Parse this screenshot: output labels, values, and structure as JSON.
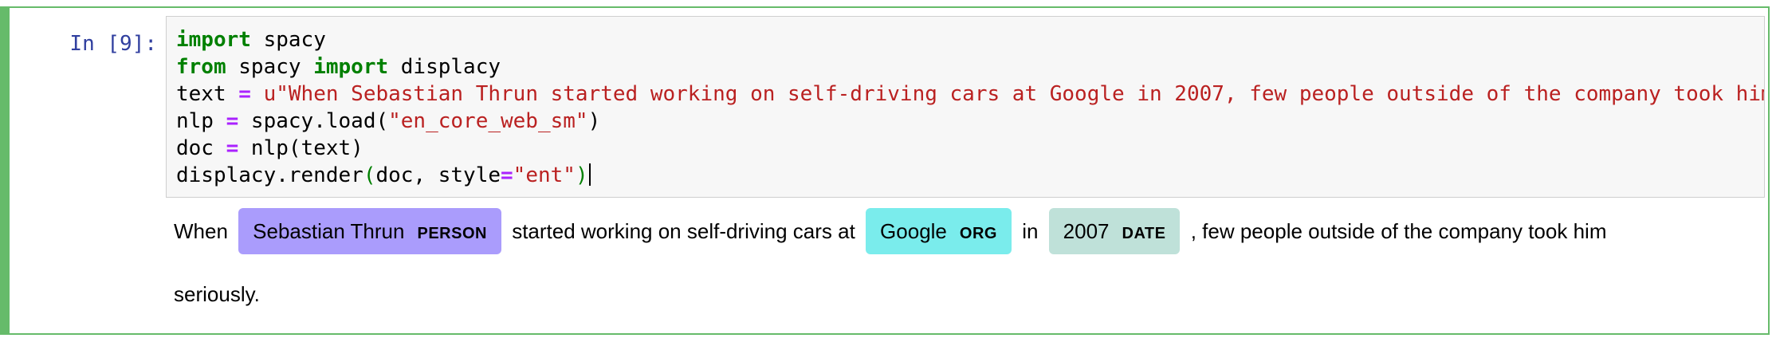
{
  "cell": {
    "prompt": "In [9]:",
    "code_lines": [
      [
        {
          "t": "import",
          "c": "kw"
        },
        {
          "t": " spacy",
          "c": ""
        }
      ],
      [
        {
          "t": "from",
          "c": "kw"
        },
        {
          "t": " spacy ",
          "c": ""
        },
        {
          "t": "import",
          "c": "kw"
        },
        {
          "t": " displacy",
          "c": ""
        }
      ],
      [
        {
          "t": "text ",
          "c": ""
        },
        {
          "t": "=",
          "c": "op"
        },
        {
          "t": " ",
          "c": ""
        },
        {
          "t": "u\"When Sebastian Thrun started working on self-driving cars at Google in 2007, few people outside of the company took him seriously.\"",
          "c": "str"
        }
      ],
      [
        {
          "t": "nlp ",
          "c": ""
        },
        {
          "t": "=",
          "c": "op"
        },
        {
          "t": " spacy.load(",
          "c": ""
        },
        {
          "t": "\"en_core_web_sm\"",
          "c": "str"
        },
        {
          "t": ")",
          "c": ""
        }
      ],
      [
        {
          "t": "doc ",
          "c": ""
        },
        {
          "t": "=",
          "c": "op"
        },
        {
          "t": " nlp(text)",
          "c": ""
        }
      ],
      [
        {
          "t": "displacy.render",
          "c": ""
        },
        {
          "t": "(",
          "c": "paren-g"
        },
        {
          "t": "doc, style",
          "c": ""
        },
        {
          "t": "=",
          "c": "op"
        },
        {
          "t": "\"ent\"",
          "c": "str"
        },
        {
          "t": ")",
          "c": "paren-g"
        }
      ]
    ]
  },
  "output": {
    "line1": {
      "word1": "When",
      "ent1": {
        "text": "Sebastian Thrun",
        "label": "PERSON"
      },
      "word2": "started working on self-driving cars at",
      "ent2": {
        "text": "Google",
        "label": "ORG"
      },
      "word3": "in",
      "ent3": {
        "text": "2007",
        "label": "DATE"
      },
      "word4": ", few people outside of the company took him"
    },
    "line2": "seriously."
  },
  "colors": {
    "cell_border": "#66bb6a",
    "prompt": "#303f9f",
    "keyword": "#008000",
    "operator": "#aa22ff",
    "string": "#ba2121",
    "person": "#aa9cfc",
    "org": "#7aecec",
    "date": "#bfe1d9"
  }
}
